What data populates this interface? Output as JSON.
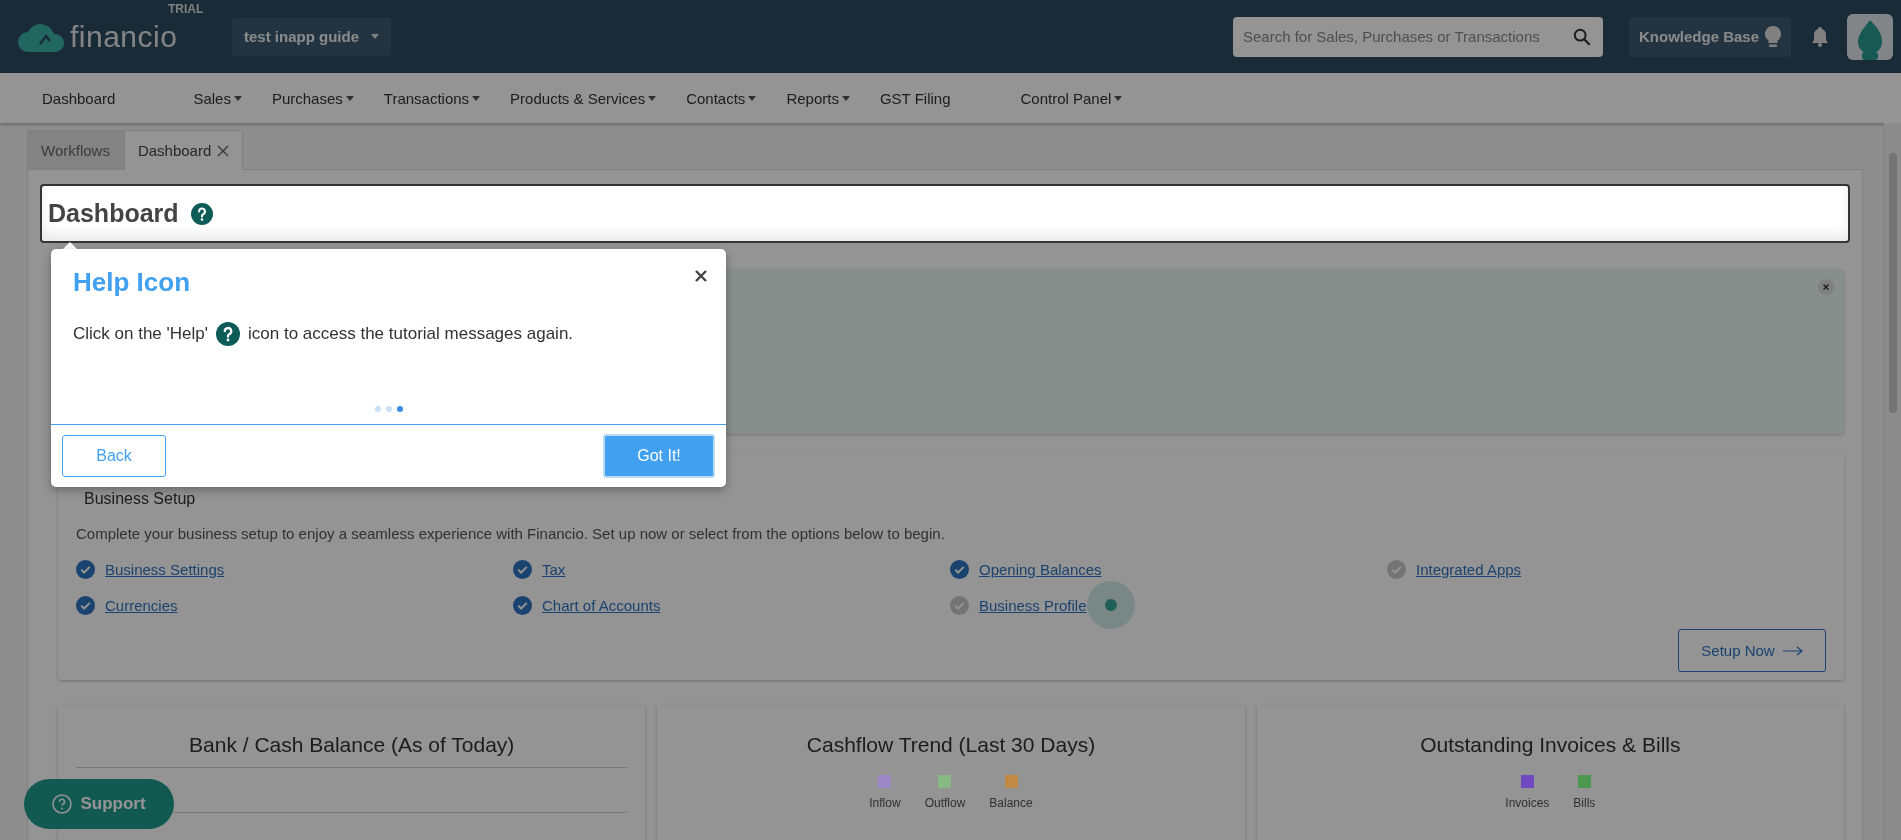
{
  "app": {
    "logo": "financio",
    "badge": "TRIAL",
    "organization": "test inapp guide",
    "search": {
      "placeholder": "Search for Sales, Purchases or Transactions"
    },
    "knowledge_base": "Knowledge Base"
  },
  "nav": [
    {
      "label": "Dashboard",
      "has_menu": false
    },
    {
      "label": "Sales",
      "has_menu": true
    },
    {
      "label": "Purchases",
      "has_menu": true
    },
    {
      "label": "Transactions",
      "has_menu": true
    },
    {
      "label": "Products & Services",
      "has_menu": true
    },
    {
      "label": "Contacts",
      "has_menu": true
    },
    {
      "label": "Reports",
      "has_menu": true
    },
    {
      "label": "GST Filing",
      "has_menu": false
    },
    {
      "label": "Control Panel",
      "has_menu": true
    }
  ],
  "tabs": [
    {
      "label": "Workflows",
      "selected": false,
      "closable": false
    },
    {
      "label": "Dashboard",
      "selected": true,
      "closable": true
    }
  ],
  "page_title": "Dashboard",
  "tour": {
    "title": "Help Icon",
    "text_before": "Click on the 'Help'",
    "text_after": "icon to access the tutorial messages again.",
    "steps": [
      {
        "selected": false
      },
      {
        "selected": false
      },
      {
        "selected": true
      }
    ],
    "back": "Back",
    "done": "Got It!"
  },
  "business_setup": {
    "title": "Business Setup",
    "description": "Complete your business setup to enjoy a seamless experience with Financio. Set up now or select from the options below to begin.",
    "items": [
      {
        "label": "Business Settings",
        "done": true
      },
      {
        "label": "Tax",
        "done": true
      },
      {
        "label": "Opening Balances",
        "done": true
      },
      {
        "label": "Integrated Apps",
        "done": false
      },
      {
        "label": "Currencies",
        "done": true
      },
      {
        "label": "Chart of Accounts",
        "done": true
      },
      {
        "label": "Business Profile",
        "done": false
      }
    ],
    "action": "Setup Now"
  },
  "widgets": [
    {
      "title": "Bank / Cash Balance (As of Today)"
    },
    {
      "title": "Cashflow Trend (Last 30 Days)",
      "legend": [
        {
          "label": "Inflow",
          "color": "#9c88c4"
        },
        {
          "label": "Outflow",
          "color": "#88b884"
        },
        {
          "label": "Balance",
          "color": "#c08a44"
        }
      ]
    },
    {
      "title": "Outstanding Invoices & Bills",
      "legend": [
        {
          "label": "Invoices",
          "color": "#7048c0"
        },
        {
          "label": "Bills",
          "color": "#4c984f"
        }
      ]
    }
  ],
  "support": "Support"
}
